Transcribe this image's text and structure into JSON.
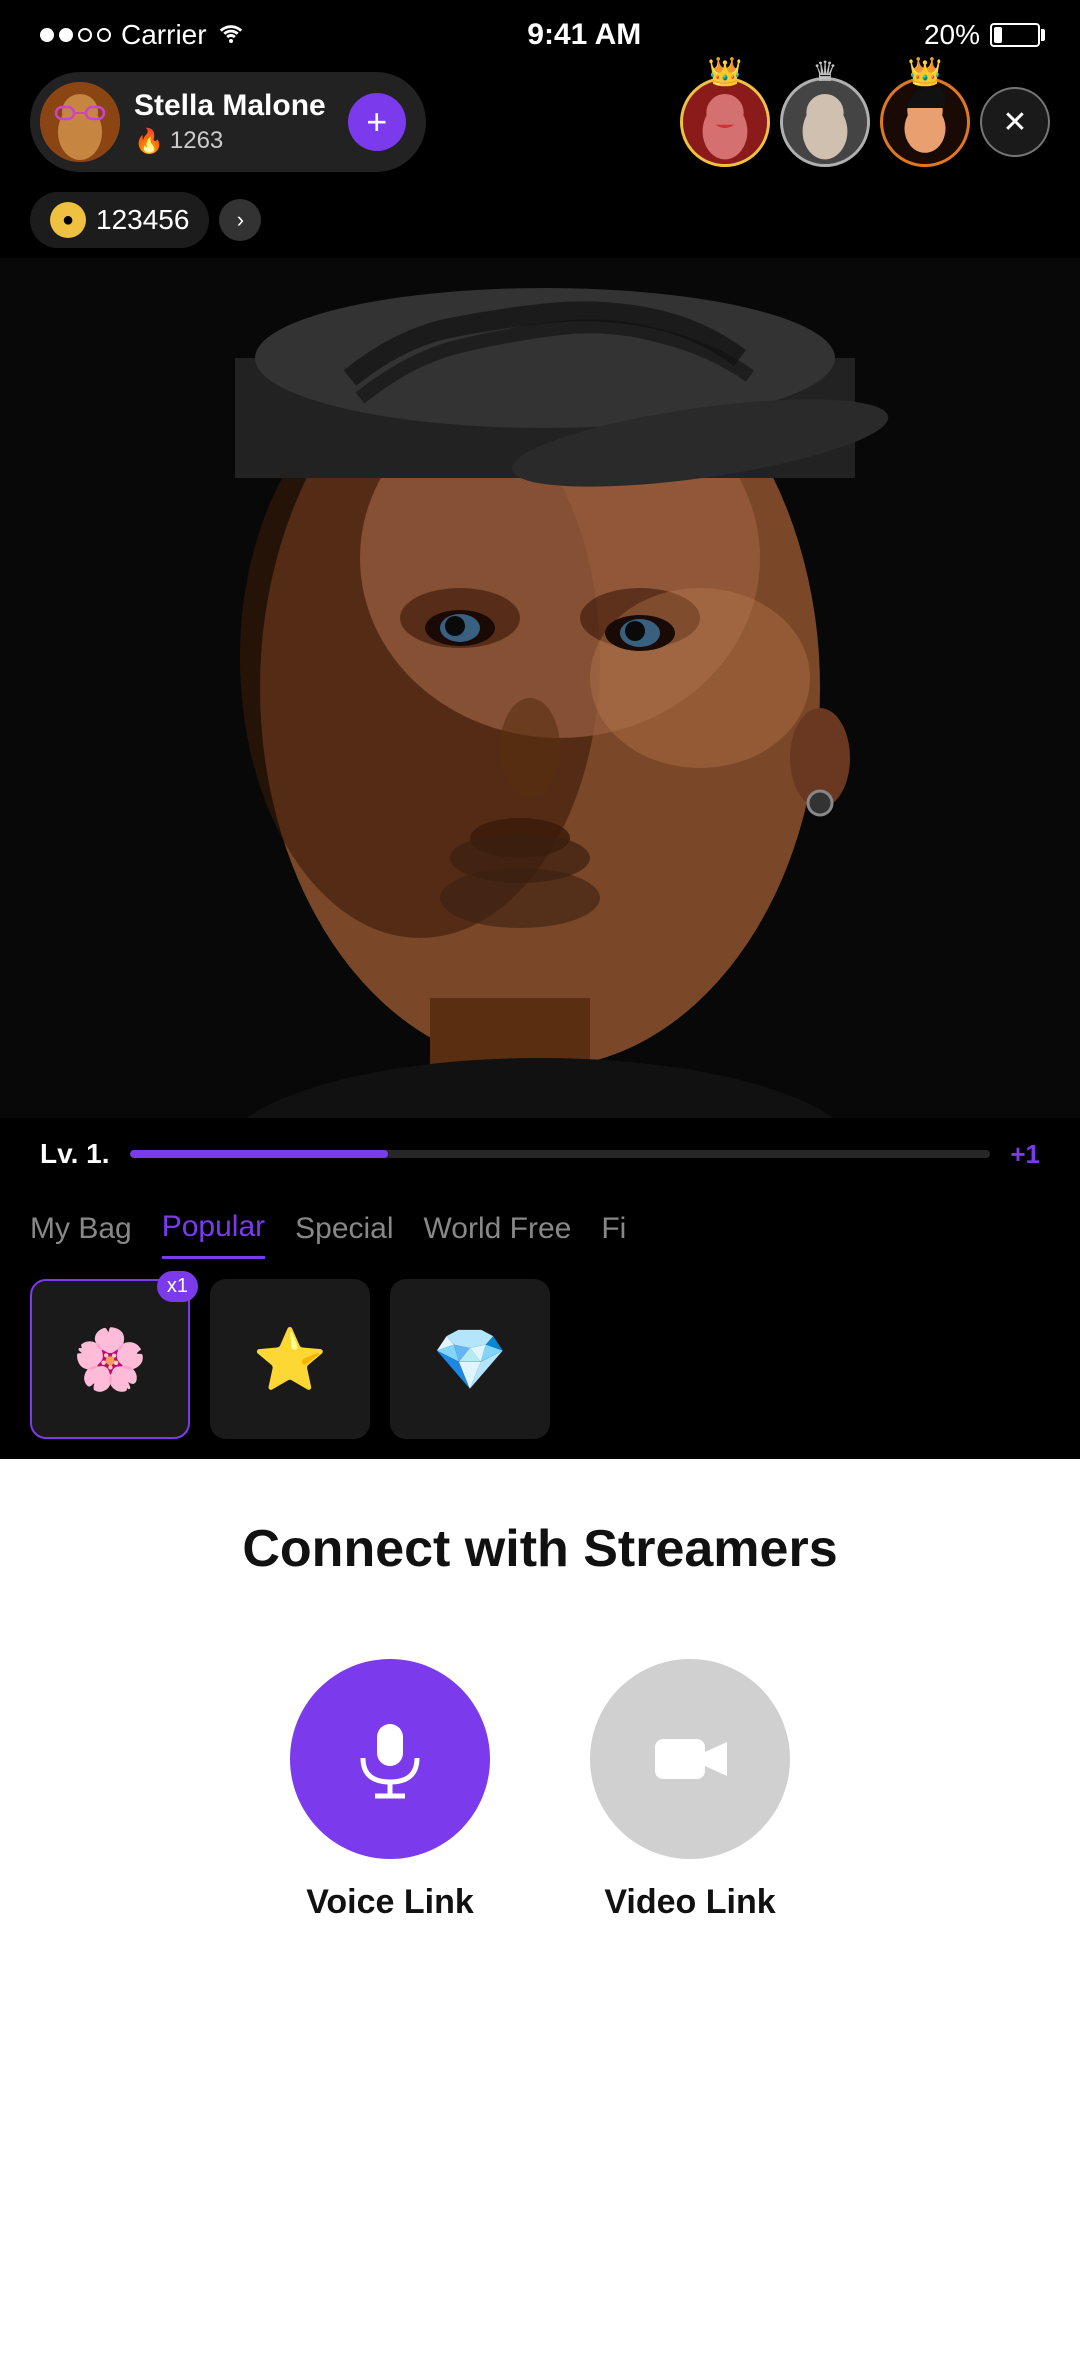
{
  "statusBar": {
    "carrier": "Carrier",
    "time": "9:41 AM",
    "battery": "20%"
  },
  "userCard": {
    "name": "Stella Malone",
    "streak": "1263",
    "addLabel": "+"
  },
  "coins": {
    "amount": "123456"
  },
  "crownAvatars": [
    {
      "rank": 1,
      "crown": "👑",
      "crownColor": "gold"
    },
    {
      "rank": 2,
      "crown": "👑",
      "crownColor": "silver"
    },
    {
      "rank": 3,
      "crown": "👑",
      "crownColor": "orange"
    }
  ],
  "level": {
    "label": "Lv. 1.",
    "plusLabel": "+1",
    "fillPercent": 30
  },
  "tabs": [
    {
      "id": "my-bag",
      "label": "My Bag",
      "active": false
    },
    {
      "id": "popular",
      "label": "Popular",
      "active": true
    },
    {
      "id": "special",
      "label": "Special",
      "active": false
    },
    {
      "id": "world-free",
      "label": "World Free",
      "active": false
    },
    {
      "id": "fi",
      "label": "Fi",
      "active": false
    }
  ],
  "giftItems": [
    {
      "id": "gift-1",
      "emoji": "🌸",
      "badge": "x1",
      "active": true
    },
    {
      "id": "gift-2",
      "emoji": "⭐",
      "badge": null,
      "active": false
    }
  ],
  "bottom": {
    "title": "Connect with Streamers",
    "voiceLink": "Voice Link",
    "videoLink": "Video Link"
  }
}
